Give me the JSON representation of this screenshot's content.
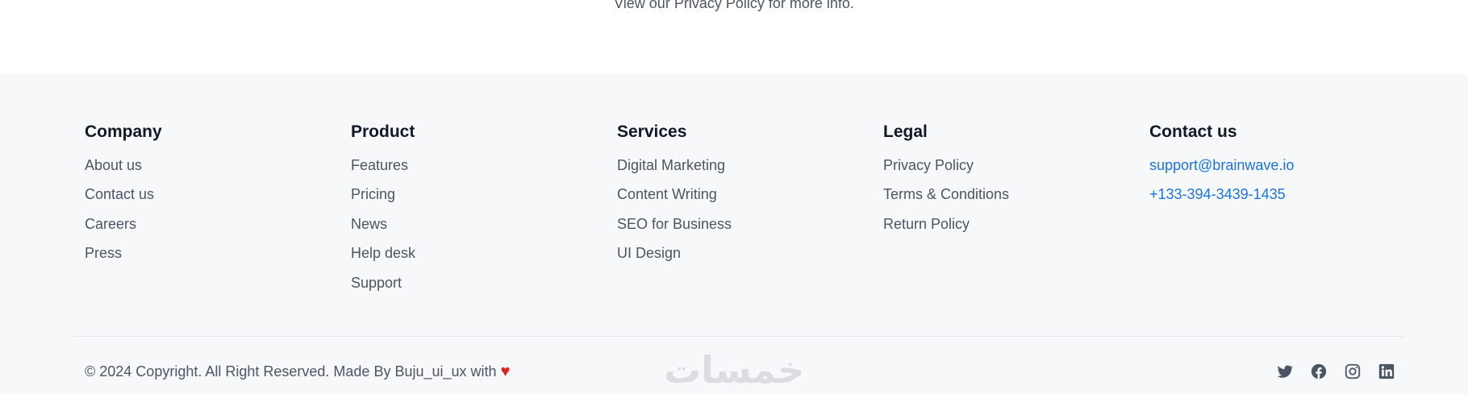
{
  "privacy_note": "View our Privacy Policy for more info.",
  "footer": {
    "columns": [
      {
        "title": "Company",
        "items": [
          "About us",
          "Contact us",
          "Careers",
          "Press"
        ]
      },
      {
        "title": "Product",
        "items": [
          "Features",
          "Pricing",
          "News",
          "Help desk",
          "Support"
        ]
      },
      {
        "title": "Services",
        "items": [
          "Digital Marketing",
          "Content Writing",
          "SEO for Business",
          "UI Design"
        ]
      },
      {
        "title": "Legal",
        "items": [
          "Privacy Policy",
          "Terms & Conditions",
          "Return Policy"
        ]
      },
      {
        "title": "Contact us",
        "items": [
          "support@brainwave.io",
          "+133-394-3439-1435"
        ]
      }
    ],
    "copyright": "© 2024 Copyright. All Right Reserved. Made By Buju_ui_ux with",
    "heart_icon": "heart-icon",
    "watermark_text": "خمسات",
    "socials": [
      "twitter-icon",
      "facebook-icon",
      "instagram-icon",
      "linkedin-icon"
    ],
    "colors": {
      "link": "#1a73e8",
      "text": "#4b5563",
      "heading": "#111827",
      "heart": "#dc2626",
      "background": "#f7f8fa"
    }
  }
}
